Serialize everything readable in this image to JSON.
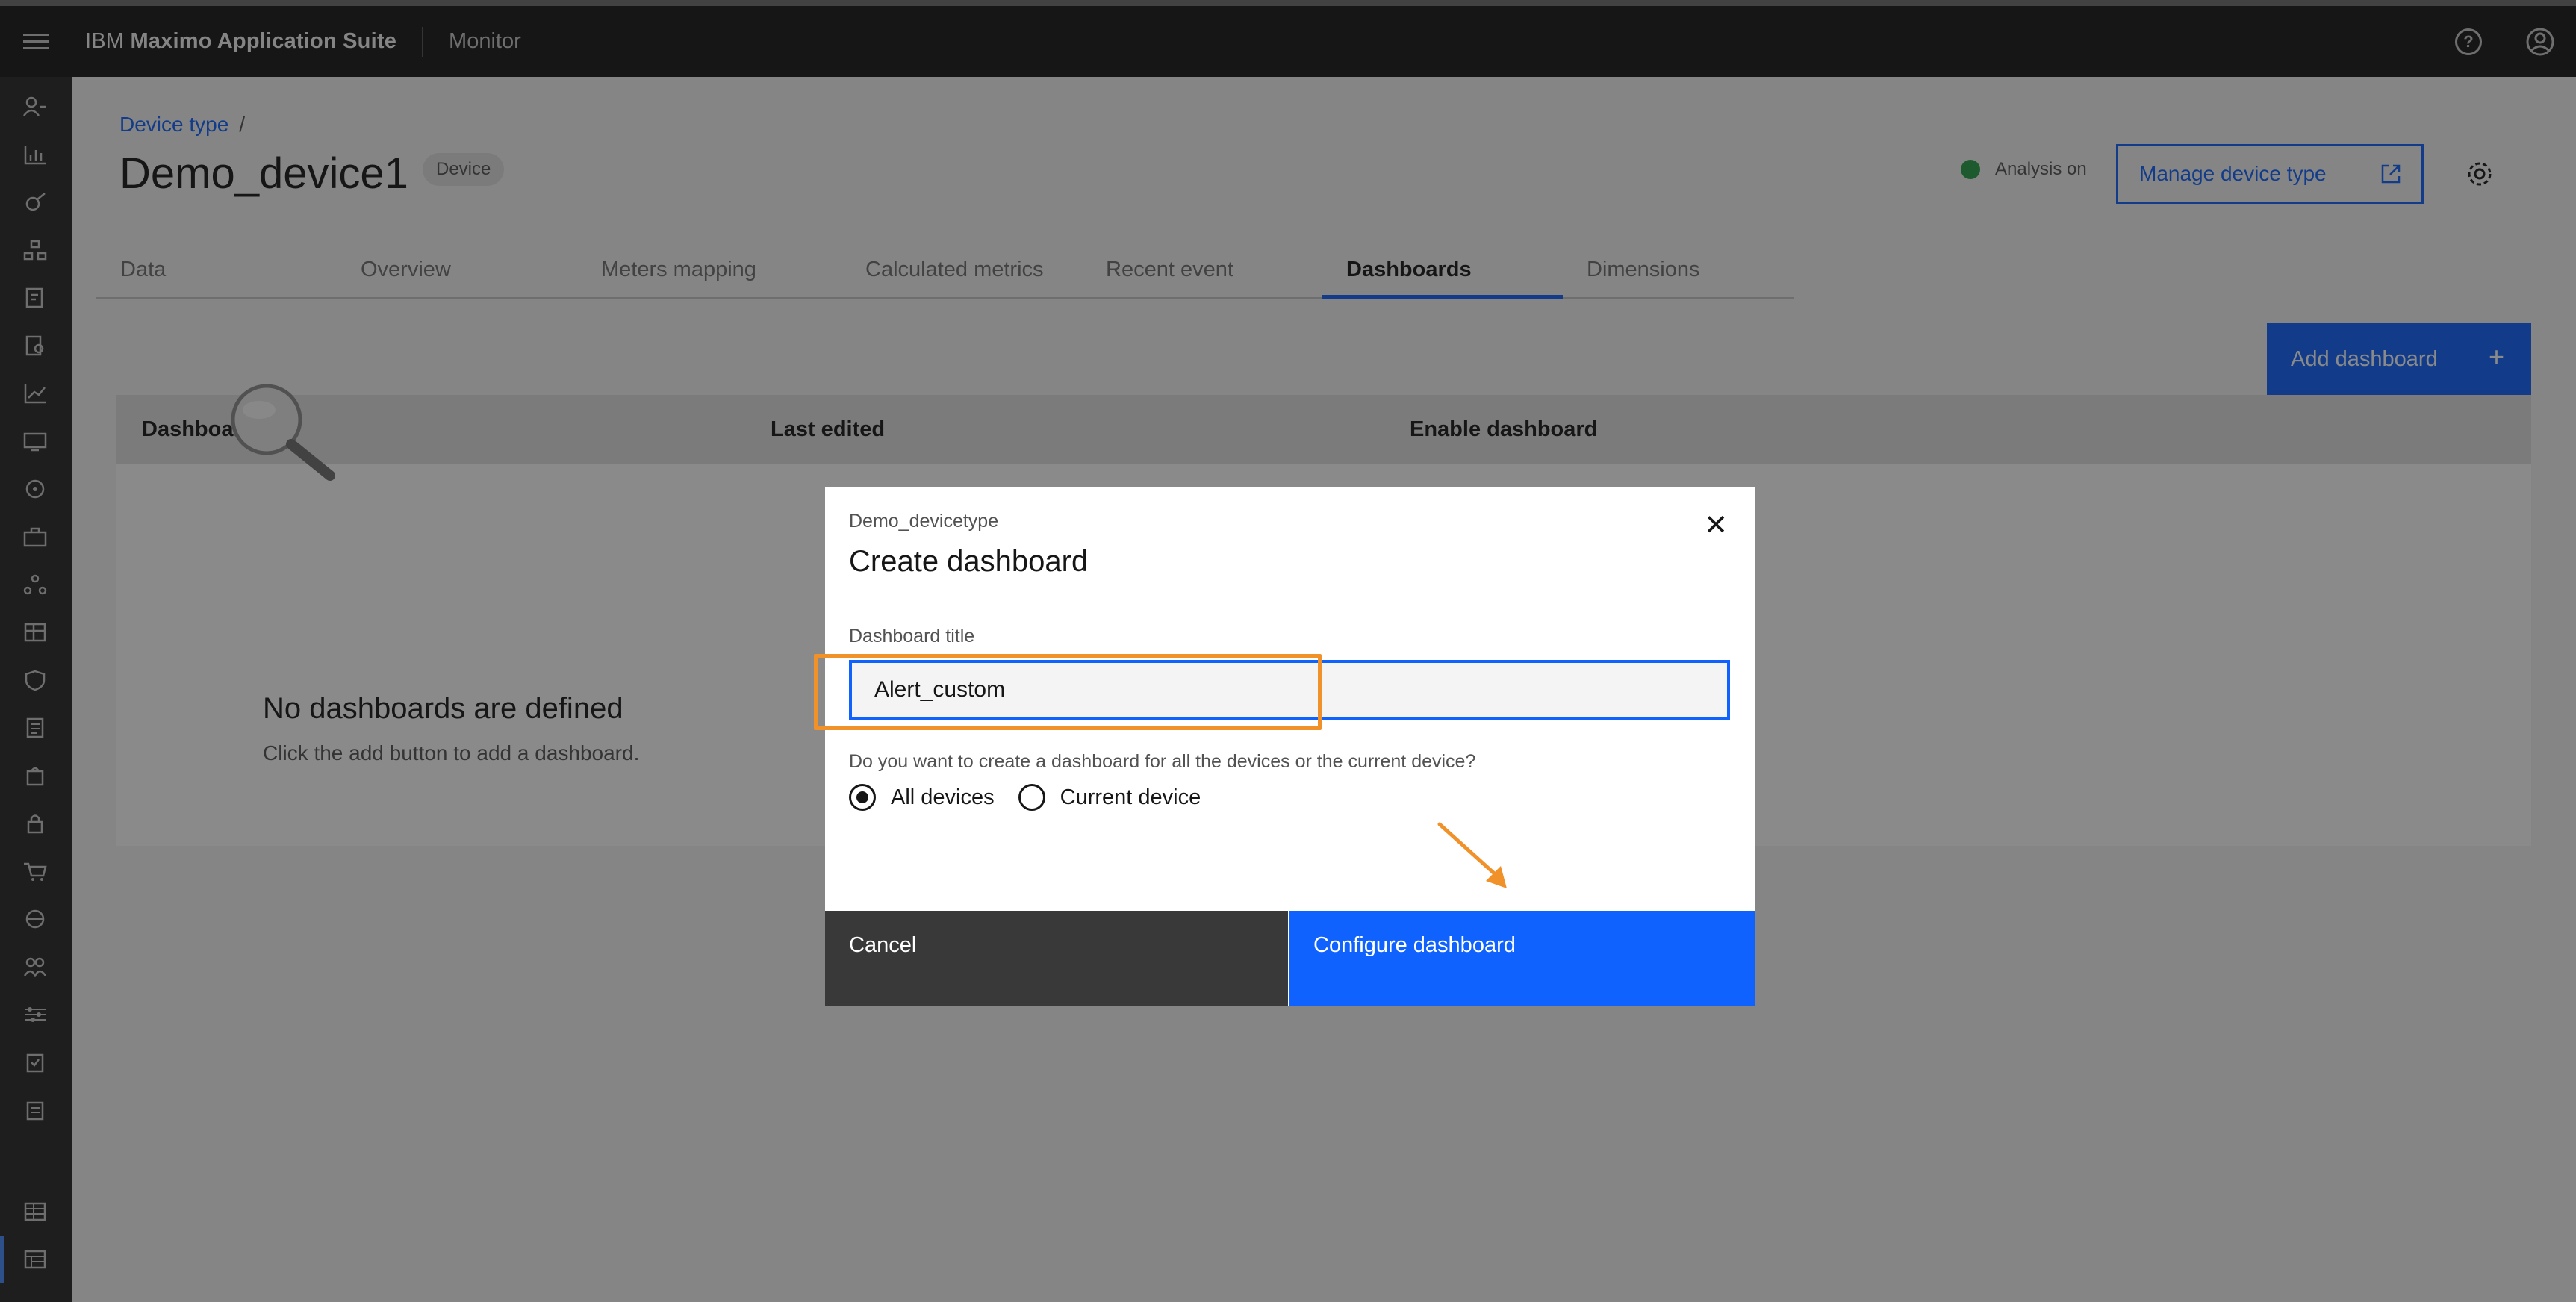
{
  "header": {
    "brand_prefix": "IBM",
    "brand_name": "Maximo Application Suite",
    "app_name": "Monitor"
  },
  "page": {
    "breadcrumb": "Device type",
    "breadcrumb_sep": "/",
    "title": "Demo_device1",
    "tag": "Device",
    "analysis_label": "Analysis on",
    "manage_button": "Manage device type"
  },
  "tabs": [
    {
      "label": "Data"
    },
    {
      "label": "Overview"
    },
    {
      "label": "Meters mapping"
    },
    {
      "label": "Calculated metrics"
    },
    {
      "label": "Recent event"
    },
    {
      "label": "Dashboards"
    },
    {
      "label": "Dimensions"
    }
  ],
  "active_tab": "Dashboards",
  "table": {
    "add_button": "Add dashboard",
    "add_icon": "+",
    "columns": [
      "Dashboard",
      "Last edited",
      "Enable dashboard"
    ],
    "empty_title": "No dashboards are defined",
    "empty_subtitle": "Click the add button to add a dashboard."
  },
  "modal": {
    "label": "Demo_devicetype",
    "heading": "Create dashboard",
    "close_icon": "✕",
    "field_label": "Dashboard title",
    "field_value": "Alert_custom",
    "question": "Do you want to create a dashboard for all the devices or the current device?",
    "options": [
      {
        "label": "All devices",
        "checked": true
      },
      {
        "label": "Current device",
        "checked": false
      }
    ],
    "cancel_button": "Cancel",
    "primary_button": "Configure dashboard"
  },
  "colors": {
    "primary": "#0f62fe",
    "annotation": "#f1912a",
    "status_green": "#24a148"
  }
}
